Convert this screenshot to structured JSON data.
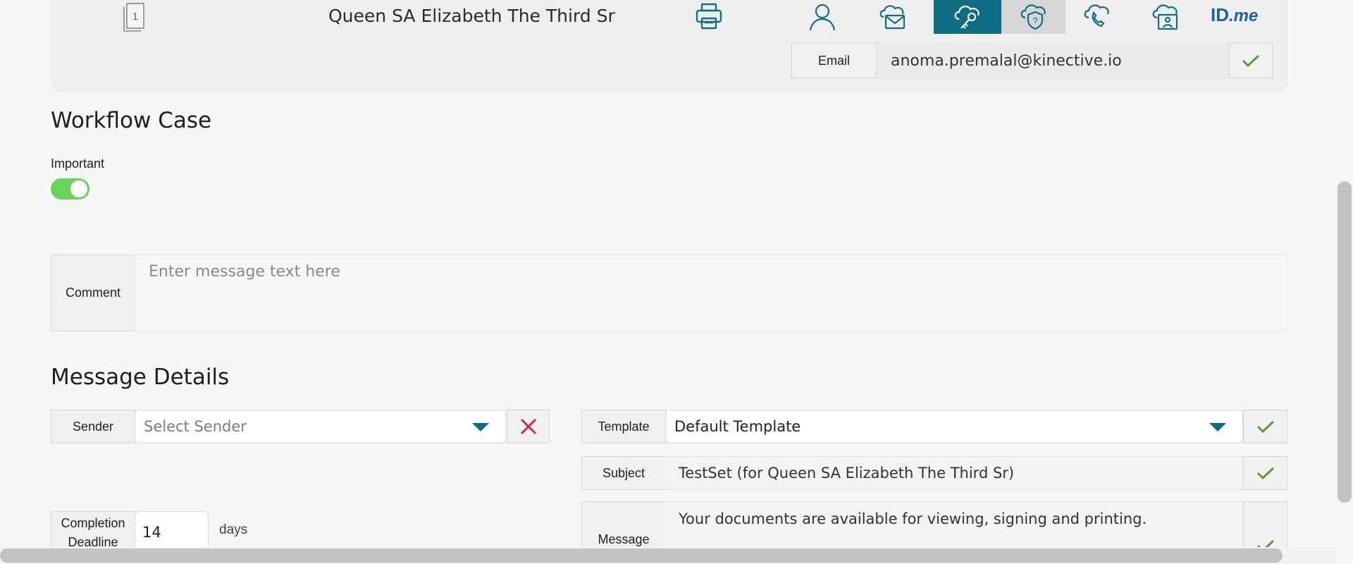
{
  "header": {
    "document_count": "1",
    "recipient_name": "Queen SA Elizabeth The Third Sr",
    "auth_methods": [
      {
        "icon": "person-icon",
        "selected": false
      },
      {
        "icon": "email-icon",
        "selected": false
      },
      {
        "icon": "cloud-key-icon",
        "selected": true
      },
      {
        "icon": "cloud-shield-question-icon",
        "selected": false
      },
      {
        "icon": "cloud-phone-icon",
        "selected": false
      },
      {
        "icon": "cloud-id-card-icon",
        "selected": false
      }
    ],
    "idme_logo": {
      "id": "ID",
      "dot_me": ".me"
    },
    "email_label": "Email",
    "email_value": "anoma.premalal@kinective.io"
  },
  "workflow": {
    "title": "Workflow Case",
    "important_label": "Important",
    "important_on": true,
    "comment_label": "Comment",
    "comment_placeholder": "Enter message text here"
  },
  "message_details": {
    "title": "Message Details",
    "sender_label": "Sender",
    "sender_placeholder": "Select Sender",
    "template_label": "Template",
    "template_value": "Default Template",
    "subject_label": "Subject",
    "subject_value": "TestSet (for Queen SA Elizabeth The Third Sr)",
    "message_label": "Message",
    "message_value": "Your documents are available for viewing, signing and printing.",
    "deadline_label_line1": "Completion",
    "deadline_label_line2": "Deadline",
    "deadline_value": "14",
    "deadline_unit": "days"
  },
  "colors": {
    "accent": "#0e6d82",
    "check_green": "#5a9e2f",
    "clear_red": "#d42a35",
    "toggle_on": "#6bd35a"
  }
}
